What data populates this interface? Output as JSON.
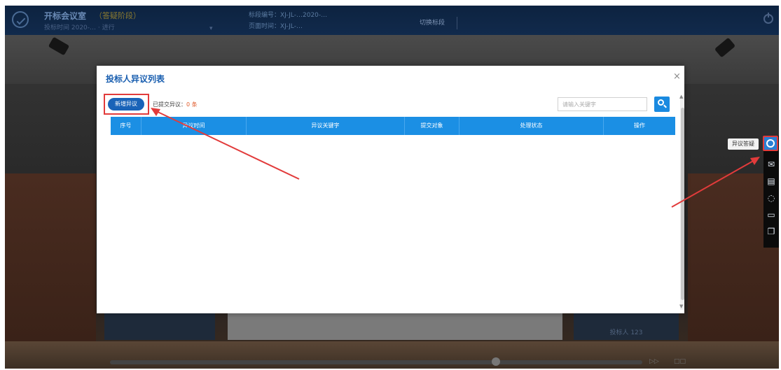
{
  "topbar": {
    "title": "开标会议室",
    "badge": "（答疑阶段）",
    "subtitle": "投标时间 2020-…  ·  进行",
    "small_text": "▾",
    "info_line1": "标段编号：XJ-JL-…2020-…",
    "info_line2": "页面时间：XJ-JL-…",
    "button_label": "切换标段"
  },
  "modal": {
    "title": "投标人异议列表",
    "close_symbol": "×",
    "new_button": "新增异议",
    "count_label": "已提交异议：",
    "count_value": "0 条",
    "search_placeholder": "请输入关键字",
    "columns": [
      "序号",
      "异议时间",
      "异议关键字",
      "提交对象",
      "处理状态",
      "操作"
    ]
  },
  "side_toolbar": {
    "tooltip": "异议答疑",
    "icons": [
      "question-circle-icon",
      "mail-icon",
      "clipboard-icon",
      "chat-bubble-icon",
      "comment-icon",
      "copy-icon"
    ]
  },
  "bottom": {
    "panel_right_text": "投标人 123",
    "ctrl_1": "▷▷",
    "ctrl_2": "□□"
  },
  "colors": {
    "header_blue": "#1b8fe4",
    "accent_blue": "#1a63b8",
    "annotation_red": "#e23b3b"
  }
}
